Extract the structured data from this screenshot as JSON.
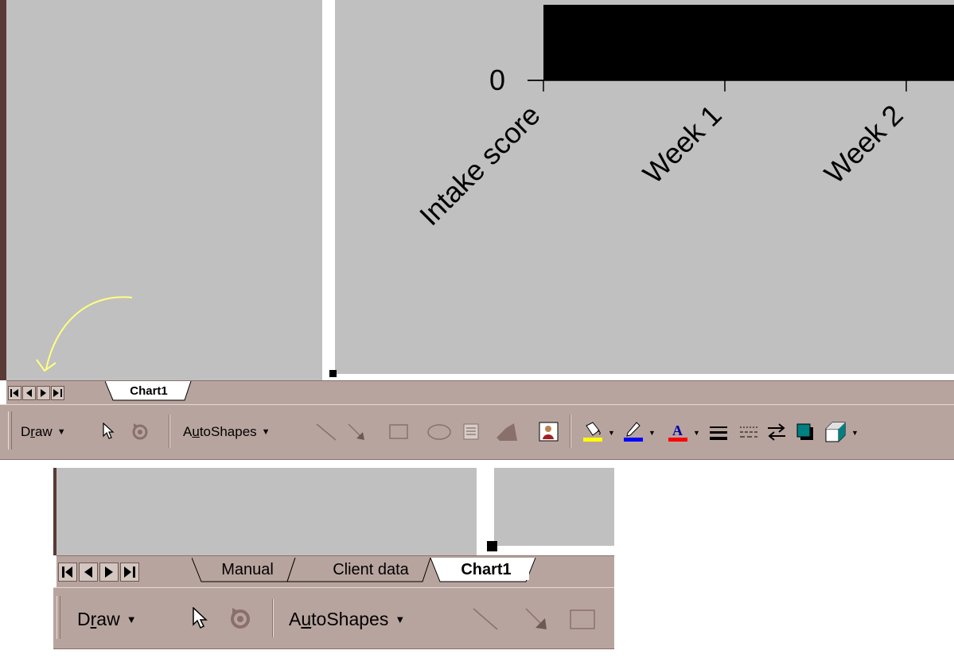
{
  "chart": {
    "chart_data": {
      "type": "bar",
      "categories": [
        "Intake score",
        "Week 1",
        "Week 2"
      ],
      "series": [
        {
          "values": [
            null,
            null,
            null
          ]
        }
      ],
      "ytick_labels": [
        "0"
      ],
      "bar_color": "#000000",
      "plot_background": "#c0c0c0"
    }
  },
  "sheet_tabs_top": [
    {
      "label": "Chart1",
      "active": true
    }
  ],
  "sheet_tabs_bottom": [
    {
      "label": "Manual",
      "active": false
    },
    {
      "label": "Client data",
      "active": false
    },
    {
      "label": "Chart1",
      "active": true
    }
  ],
  "drawing_toolbar": {
    "draw_label": "Draw",
    "draw_accel": "r",
    "autoshapes_label": "AutoShapes",
    "autoshapes_accel": "u",
    "icons": [
      "select-objects-arrow",
      "free-rotate",
      "line",
      "arrow",
      "rectangle",
      "oval",
      "text-box",
      "wordart",
      "clip-art",
      "fill-color",
      "line-color",
      "font-color",
      "line-style",
      "dash-style",
      "arrow-style",
      "shadow",
      "3d"
    ]
  },
  "annotation": {
    "color": "#ffff80",
    "meaning": "arrow pointing to sheet navigation buttons"
  },
  "colors": {
    "window_gray": "#c0c0c0",
    "chrome_mauve": "#b8a49e",
    "fill_yellow": "#ffff00",
    "line_blue": "#0000ff",
    "font_red": "#ff0000",
    "shadow_teal": "#008080"
  }
}
